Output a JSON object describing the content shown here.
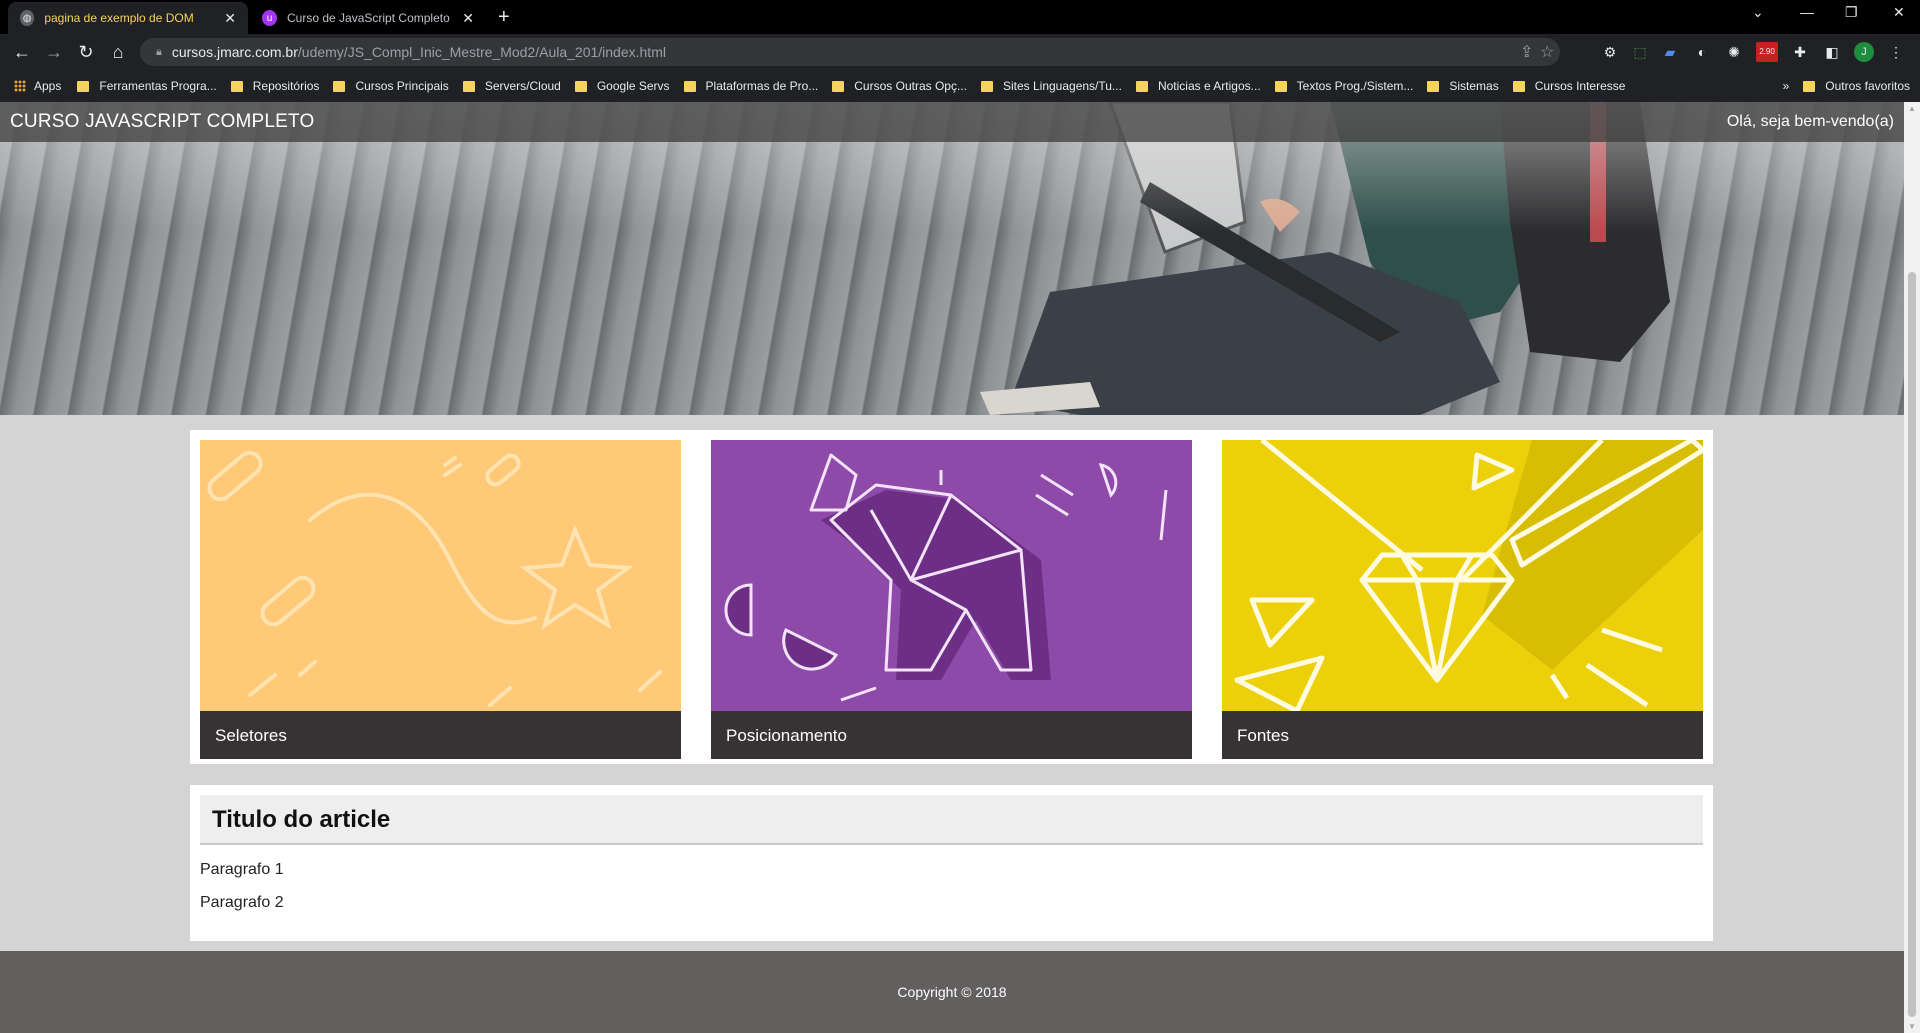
{
  "browser": {
    "tabs": [
      {
        "title": "pagina de exemplo de DOM",
        "close": "✕"
      },
      {
        "title": "Curso de JavaScript Completo do",
        "close": "✕"
      }
    ],
    "new_tab": "+",
    "url_host": "cursos.jmarc.com.br",
    "url_path": "/udemy/JS_Compl_Inic_Mestre_Mod2/Aula_201/index.html",
    "profile_initial": "J",
    "ext_badge": "2.90",
    "bookmarks": [
      "Apps",
      "Ferramentas Progra...",
      "Repositórios",
      "Cursos Principais",
      "Servers/Cloud",
      "Google Servs",
      "Plataformas de Pro...",
      "Cursos Outras Opç...",
      "Sites Linguagens/Tu...",
      "Noticias e Artigos...",
      "Textos Prog./Sistem...",
      "Sistemas",
      "Cursos Interesse"
    ],
    "bookmarks_more": "»",
    "other_bookmarks": "Outros favoritos"
  },
  "site": {
    "brand": "CURSO JAVASCRIPT COMPLETO",
    "greeting": "Olá, seja bem-vendo(a)"
  },
  "cards": [
    {
      "caption": "Seletores",
      "color": "#ffc978"
    },
    {
      "caption": "Posicionamento",
      "color": "#8e4aa8"
    },
    {
      "caption": "Fontes",
      "color": "#ecd00a"
    }
  ],
  "article": {
    "title": "Titulo do article",
    "paragraphs": [
      "Paragrafo 1",
      "Paragrafo 2"
    ]
  },
  "footer": {
    "copyright": "Copyright © 2018"
  }
}
